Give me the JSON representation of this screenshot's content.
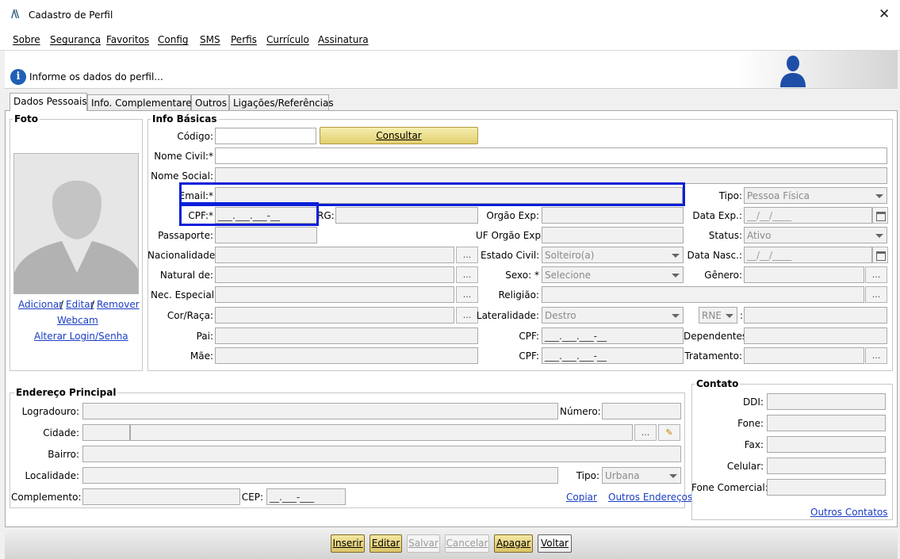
{
  "window": {
    "title": "Cadastro de Perfil",
    "close_icon": "close-icon",
    "app_icon": "app-logo-icon"
  },
  "menu": [
    "Sobre",
    "Segurança",
    "Favoritos",
    "Config",
    "SMS",
    "Perfis",
    "Currículo",
    "Assinatura"
  ],
  "banner": {
    "message": "Informe os dados do perfil...",
    "icon": "info-icon",
    "avatar": "user-silhouette-icon"
  },
  "tabs": [
    "Dados Pessoais",
    "Info. Complementares",
    "Outros",
    "Ligações/Referências"
  ],
  "foto": {
    "legend": "Foto",
    "add": "Adicionar",
    "edit": "Editar",
    "remove": "Remover",
    "sep": "/",
    "webcam": "Webcam",
    "login": "Alterar Login/Senha"
  },
  "info": {
    "legend": "Info Básicas",
    "codigo": "Código:",
    "consultar": "Consultar",
    "nome_civil": "Nome Civil:*",
    "nome_social": "Nome Social:",
    "email": "Email:*",
    "tipo": "Tipo:",
    "tipo_val": "Pessoa Física",
    "cpf": "CPF:*",
    "cpf_val": "___.___.___-__",
    "rg": "RG:",
    "orgao_exp": "Orgão Exp:",
    "data_exp": "Data Exp.:",
    "date_mask": "__/__/____",
    "passaporte": "Passaporte:",
    "uf_orgao": "UF Orgão Exp:",
    "status": "Status:",
    "status_val": "Ativo",
    "nacionalidade": "Nacionalidade:",
    "estado_civil": "Estado Civil:",
    "estado_civil_val": "Solteiro(a)",
    "data_nasc": "Data Nasc.:",
    "natural": "Natural de:",
    "sexo": "Sexo: *",
    "sexo_val": "Selecione",
    "genero": "Gênero:",
    "nec_especial": "Nec. Especial:",
    "religiao": "Religião:",
    "cor": "Cor/Raça:",
    "lateralidade": "Lateralidade:",
    "lateralidade_val": "Destro",
    "rne": "RNE",
    "colon": ":",
    "pai": "Pai:",
    "cpf2": "CPF:",
    "dependentes": "Dependentes:",
    "mae": "Mãe:",
    "cpf3": "CPF:",
    "tratamento": "Tratamento:",
    "ellipsis": "..."
  },
  "endereco": {
    "legend": "Endereço Principal",
    "logradouro": "Logradouro:",
    "numero": "Número:",
    "cidade": "Cidade:",
    "bairro": "Bairro:",
    "localidade": "Localidade:",
    "tipo": "Tipo:",
    "tipo_val": "Urbana",
    "complemento": "Complemento:",
    "cep": "CEP:",
    "cep_val": "__.___-___",
    "copiar": "Copiar",
    "outros": "Outros Endereços",
    "edit_icon": "pencil-icon"
  },
  "contato": {
    "legend": "Contato",
    "ddi": "DDI:",
    "fone": "Fone:",
    "fax": "Fax:",
    "celular": "Celular:",
    "fone_comercial": "Fone Comercial:",
    "outros": "Outros Contatos"
  },
  "actions": {
    "inserir": "Inserir",
    "editar": "Editar",
    "salvar": "Salvar",
    "cancelar": "Cancelar",
    "apagar": "Apagar",
    "voltar": "Voltar"
  },
  "colors": {
    "highlight": "#0a1fd8",
    "button_gold": "#e2cf70",
    "link": "#1a3dc4",
    "info_blue": "#1f5fb5"
  }
}
